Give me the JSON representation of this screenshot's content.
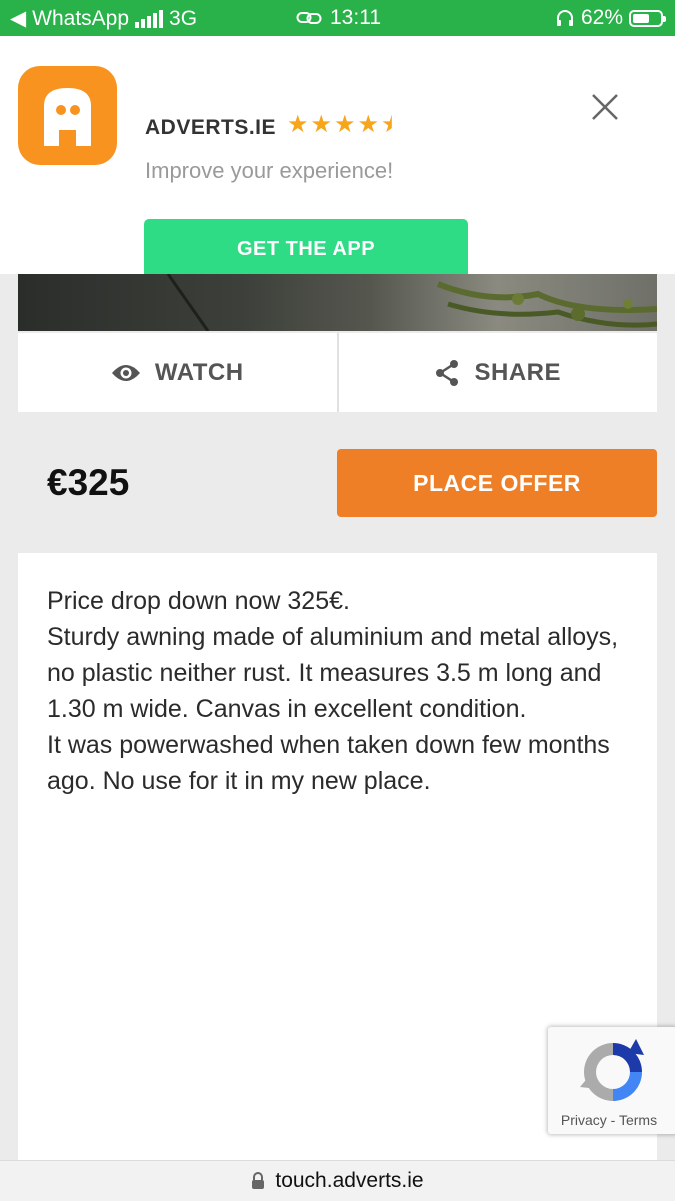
{
  "status_bar": {
    "back_app": "WhatsApp",
    "network": "3G",
    "time": "13:11",
    "battery": "62%",
    "battery_level": 0.62
  },
  "banner": {
    "app_name": "ADVERTS.IE",
    "rating": 4.5,
    "subtitle": "Improve your experience!",
    "cta": "GET THE APP",
    "icon": "adverts-logo-icon",
    "accent": "#2ddc85",
    "brand": "#f7931e"
  },
  "actions": {
    "watch": "WATCH",
    "share": "SHARE"
  },
  "listing": {
    "price": "€325",
    "offer_button": "PLACE OFFER",
    "offer_color": "#ee7f27",
    "description": [
      "Price drop down now 325€.",
      "Sturdy awning made of aluminium and metal alloys, no plastic neither rust. It measures 3.5 m long and 1.30 m wide. Canvas in excellent condition.",
      "It was powerwashed when taken down few months ago. No use for it in my new place."
    ]
  },
  "recaptcha": {
    "privacy": "Privacy",
    "separator": "-",
    "terms": "Terms"
  },
  "url_bar": {
    "url": "touch.adverts.ie"
  }
}
